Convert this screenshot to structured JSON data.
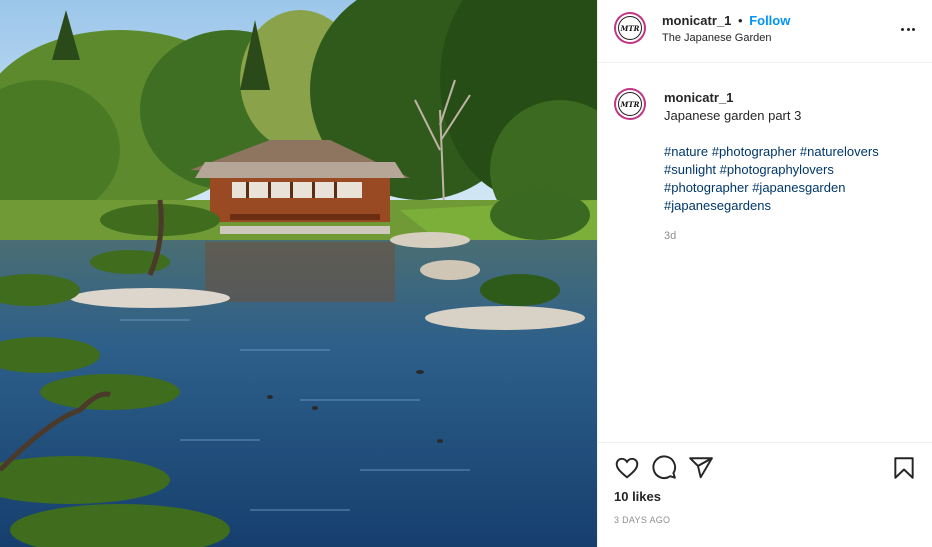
{
  "post": {
    "photo_alt": "",
    "header": {
      "avatar_text": "MTR",
      "username": "monicatr_1",
      "separator": "•",
      "follow_label": "Follow",
      "location": "The Japanese Garden",
      "more_icon": "more-options-icon"
    },
    "caption": {
      "avatar_text": "MTR",
      "username": "monicatr_1",
      "text": "Japanese garden part 3",
      "hashtags": [
        "#nature",
        "#photographer",
        "#naturelovers",
        "#sunlight",
        "#photographylovers",
        "#photographer",
        "#japanesgarden",
        "#japanesegardens"
      ],
      "time": "3d"
    },
    "actions": {
      "icons": [
        "heart-icon",
        "comment-icon",
        "share-icon",
        "bookmark-icon"
      ],
      "likes": "10 likes",
      "date": "3 DAYS AGO"
    },
    "colors": {
      "follow": "#0095f6",
      "hashtag": "#00376b",
      "avatar_ring": "#c13584",
      "muted": "#8e8e8e"
    }
  }
}
